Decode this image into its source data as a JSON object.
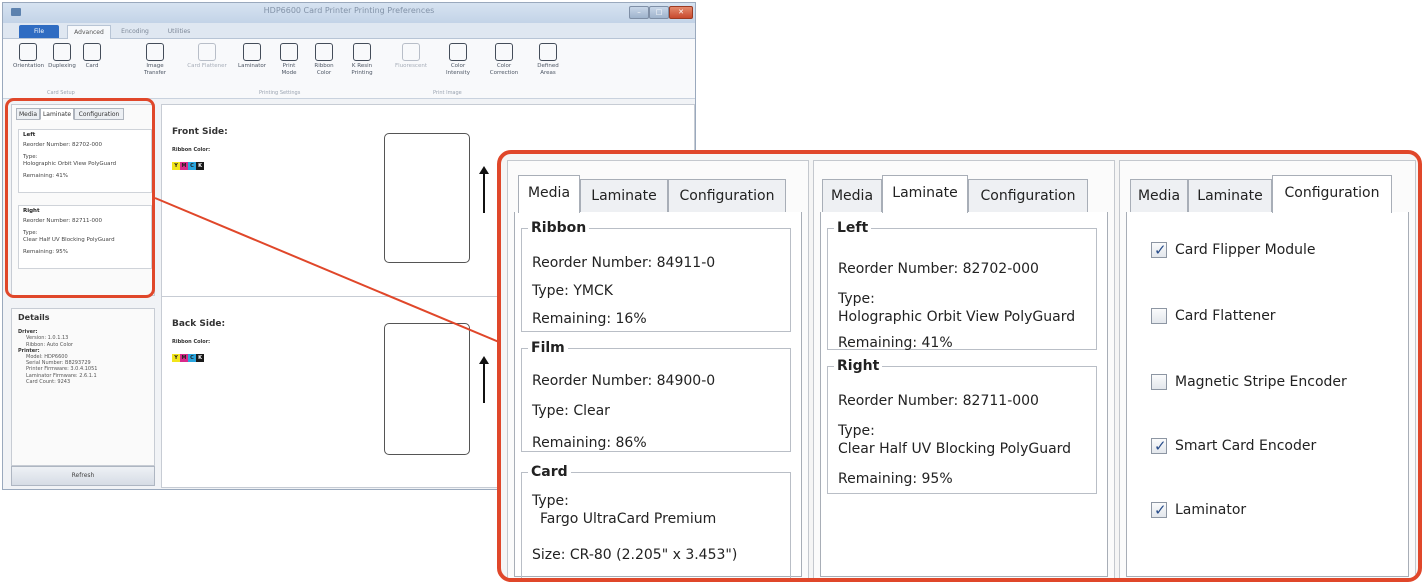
{
  "window": {
    "title": "HDP6600 Card Printer Printing Preferences",
    "ribbon_tabs": [
      "File",
      "Advanced",
      "Encoding",
      "Utilities"
    ],
    "tools": [
      "Orientation",
      "Duplexing",
      "Card",
      "Image Transfer",
      "Card Flattener",
      "Laminator",
      "Print Mode",
      "Ribbon Color",
      "K Resin Printing",
      "Fluorescent",
      "Color Intensity",
      "Color Correction",
      "Defined Areas"
    ],
    "groups": [
      "Card Setup",
      "Printing Settings",
      "Print Image"
    ]
  },
  "mini": {
    "tabs": [
      "Media",
      "Laminate",
      "Configuration"
    ],
    "left": {
      "title": "Left",
      "reorder": "Reorder Number: 82702-000",
      "type_label": "Type:",
      "type": "Holographic Orbit View PolyGuard",
      "remaining": "Remaining: 41%"
    },
    "right": {
      "title": "Right",
      "reorder": "Reorder Number: 82711-000",
      "type_label": "Type:",
      "type": "Clear Half UV Blocking PolyGuard",
      "remaining": "Remaining: 95%"
    }
  },
  "details": {
    "title": "Details",
    "driver_label": "Driver:",
    "version": "Version: 1.0.1.13",
    "ribbon": "Ribbon: Auto Color",
    "printer_label": "Printer:",
    "model": "Model: HDP6600",
    "serial": "Serial Number: B8293729",
    "printer_fw": "Printer Firmware: 3.0.4.1051",
    "laminator_fw": "Laminator Firmware: 2.6.1.1",
    "card_count": "Card Count: 9243",
    "refresh": "Refresh"
  },
  "preview": {
    "front": "Front Side:",
    "back": "Back Side:",
    "ribbon_color": "Ribbon Color:",
    "swatches": [
      {
        "letter": "Y",
        "color": "#f2e51b"
      },
      {
        "letter": "M",
        "color": "#d82a8a"
      },
      {
        "letter": "C",
        "color": "#2aa5de"
      },
      {
        "letter": "K",
        "color": "#1a1a1a"
      }
    ]
  },
  "callout": {
    "tabs": [
      "Media",
      "Laminate",
      "Configuration"
    ],
    "media": {
      "ribbon": {
        "title": "Ribbon",
        "reorder": "Reorder Number: 84911-0",
        "type": "Type: YMCK",
        "remaining": "Remaining: 16%"
      },
      "film": {
        "title": "Film",
        "reorder": "Reorder Number: 84900-0",
        "type": "Type: Clear",
        "remaining": "Remaining: 86%"
      },
      "card": {
        "title": "Card",
        "type_label": "Type:",
        "type": "Fargo UltraCard Premium",
        "size": "Size: CR-80 (2.205\" x 3.453\")"
      }
    },
    "laminate": {
      "left": {
        "title": "Left",
        "reorder": "Reorder Number: 82702-000",
        "type_label": "Type:",
        "type": "Holographic Orbit View PolyGuard",
        "remaining": "Remaining: 41%"
      },
      "right": {
        "title": "Right",
        "reorder": "Reorder Number: 82711-000",
        "type_label": "Type:",
        "type": "Clear Half UV Blocking PolyGuard",
        "remaining": "Remaining: 95%"
      }
    },
    "configuration": [
      {
        "label": "Card Flipper Module",
        "checked": true
      },
      {
        "label": "Card Flattener",
        "checked": false
      },
      {
        "label": "Magnetic Stripe Encoder",
        "checked": false
      },
      {
        "label": "Smart Card Encoder",
        "checked": true
      },
      {
        "label": "Laminator",
        "checked": true
      }
    ]
  },
  "colors": {
    "highlight": "#e0472a",
    "file_tab": "#2f6cc2"
  }
}
